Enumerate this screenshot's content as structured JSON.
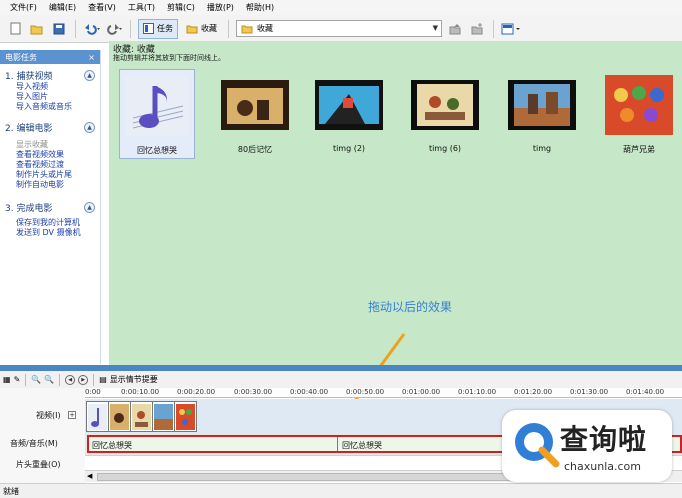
{
  "menu": [
    "文件(F)",
    "编辑(E)",
    "查看(V)",
    "工具(T)",
    "剪辑(C)",
    "播放(P)",
    "帮助(H)"
  ],
  "toolbar": {
    "task_label": "任务",
    "collections_label": "收藏",
    "collection_select": "收藏"
  },
  "taskpane": {
    "title": "电影任务",
    "close": "×",
    "sections": [
      {
        "head": "1.  捕获视频",
        "items": [
          "导入视频",
          "导入图片",
          "导入音频或音乐"
        ]
      },
      {
        "head": "2.  编辑电影",
        "items": [
          "显示收藏",
          "查看视频效果",
          "查看视频过渡",
          "制作片头或片尾",
          "制作自动电影"
        ]
      },
      {
        "head": "3.  完成电影",
        "items": [
          "保存到我的计算机",
          "发送到 DV 摄像机"
        ]
      }
    ]
  },
  "collection": {
    "title": "收藏: 收藏",
    "subtitle": "拖动剪辑并将其放到下面时间线上。",
    "clips": [
      "回忆总想哭",
      "80后记忆",
      "timg (2)",
      "timg (6)",
      "timg",
      "葫芦兄弟"
    ]
  },
  "annotation": "拖动以后的效果",
  "timeline": {
    "storyboard_label": "显示情节提要",
    "tracks": [
      "视频(I)",
      "音频/音乐(M)",
      "片头重叠(O)"
    ],
    "plus": "+",
    "ruler": [
      "0:00",
      "0:00:10.00",
      "0:00:20.00",
      "0:00:30.00",
      "0:00:40.00",
      "0:00:50.00",
      "0:01:00.00",
      "0:01:10.00",
      "0:01:20.00",
      "0:01:30.00",
      "0:01:40.00"
    ],
    "audio_clips": [
      "回忆总想哭",
      "回忆总想哭"
    ]
  },
  "status": "就绪",
  "watermark": {
    "text": "查询啦",
    "url": "chaxunla.com"
  },
  "colors": {
    "collection_bg": "#c6e8c8",
    "accent_blue": "#4a86c6",
    "annotation_blue": "#3a7fd0",
    "highlight_red": "#cc2222",
    "arrow_orange": "#f0a020"
  }
}
